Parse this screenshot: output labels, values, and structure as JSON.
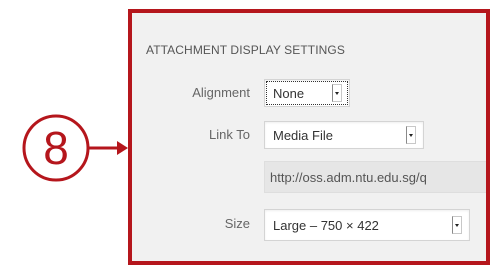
{
  "callout": {
    "step_number": "8",
    "color": "#b5161c"
  },
  "panel": {
    "title": "ATTACHMENT DISPLAY SETTINGS",
    "background": "#f1f1f1",
    "alignment": {
      "label": "Alignment",
      "value": "None"
    },
    "link_to": {
      "label": "Link To",
      "value": "Media File",
      "url": "http://oss.adm.ntu.edu.sg/q"
    },
    "size": {
      "label": "Size",
      "value": "Large – 750 × 422"
    }
  }
}
